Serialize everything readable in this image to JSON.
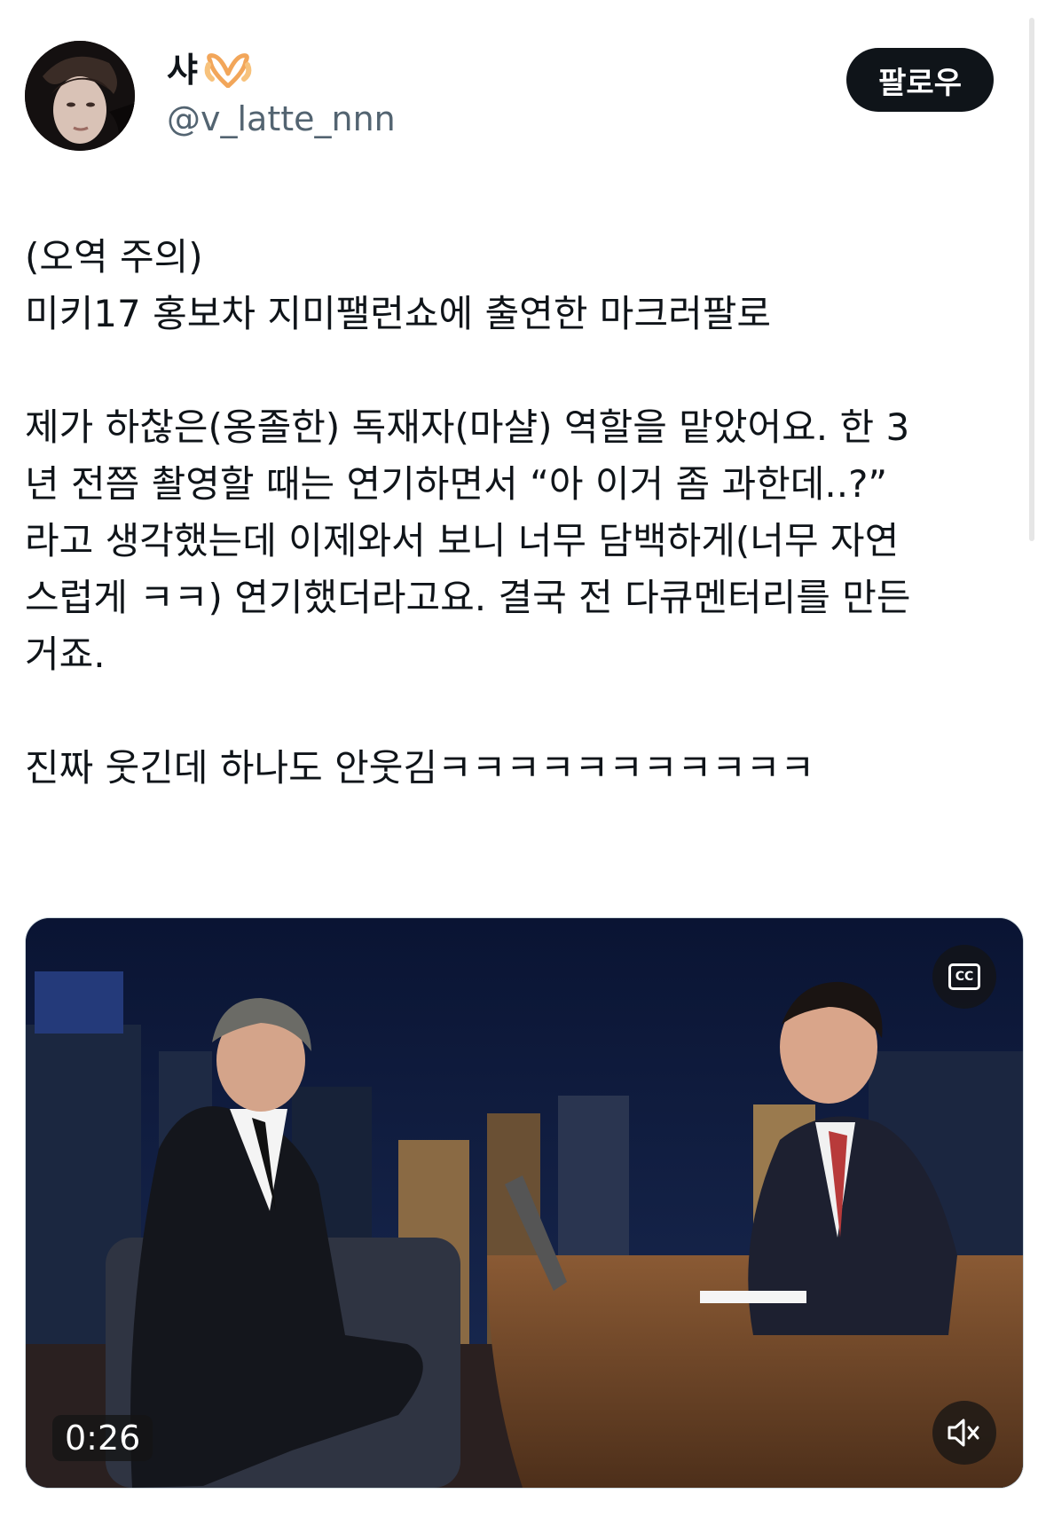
{
  "user": {
    "display_name": "샤",
    "handle": "@v_latte_nnn"
  },
  "follow_label": "팔로우",
  "tweet": {
    "text": "(오역 주의)\n미키17 홍보차 지미팰런쇼에 출연한 마크러팔로\n\n제가 하찮은(옹졸한) 독재자(마샬) 역할을 맡았어요. 한 3\n년 전쯤 촬영할 때는 연기하면서 “아 이거 좀 과한데..?”\n라고 생각했는데 이제와서 보니 너무 담백하게(너무 자연\n스럽게 ㅋㅋ) 연기했더라고요. 결국 전 다큐멘터리를 만든\n거죠.\n\n진짜 웃긴데 하나도 안웃김ㅋㅋㅋㅋㅋㅋㅋㅋㅋㅋㅋ"
  },
  "video": {
    "duration": "0:26",
    "cc_label": "CC"
  },
  "icons": {
    "heart": "heart-hands-emoji-icon",
    "cc": "closed-captions-icon",
    "mute": "speaker-muted-icon"
  },
  "colors": {
    "follow_bg": "#0f1419",
    "handle": "#536471"
  }
}
